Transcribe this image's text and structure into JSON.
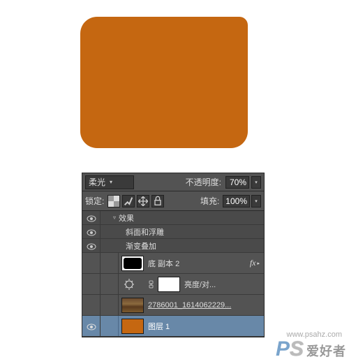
{
  "shape": {
    "color": "#c56711"
  },
  "panel": {
    "blend_mode": "柔光",
    "opacity_label": "不透明度:",
    "opacity_value": "70%",
    "lock_label": "锁定:",
    "fill_label": "填充:",
    "fill_value": "100%"
  },
  "effects": {
    "title": "效果",
    "items": [
      "斜面和浮雕",
      "渐变叠加"
    ]
  },
  "layers": [
    {
      "name": "底 副本 2",
      "visible": false,
      "fx": true,
      "type": "mask"
    },
    {
      "name": "亮度/对...",
      "visible": false,
      "type": "adjustment"
    },
    {
      "name": "2786001_1614062229...",
      "visible": false,
      "type": "texture"
    },
    {
      "name": "图层 1",
      "visible": true,
      "type": "shape",
      "selected": true
    }
  ],
  "watermark": {
    "logo_p": "P",
    "logo_s": "S",
    "text": "爱好者",
    "url": "www.psahz.com"
  }
}
